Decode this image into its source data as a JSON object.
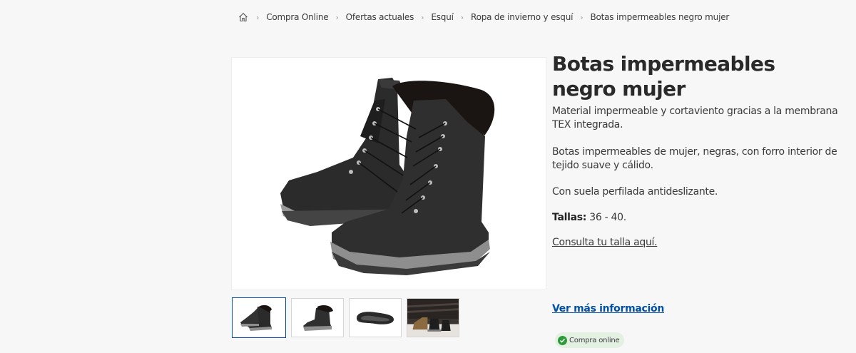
{
  "breadcrumb": {
    "home_icon": "home-icon",
    "items": [
      "Compra Online",
      "Ofertas actuales",
      "Esquí",
      "Ropa de invierno y esquí",
      "Botas impermeables negro mujer"
    ],
    "separator": "›"
  },
  "product": {
    "title": "Botas impermeables negro mujer",
    "description": [
      "Material impermeable y cortaviento gracias a la membrana TEX integrada.",
      "Botas impermeables de mujer, negras, con forro interior de tejido suave y cálido.",
      "Con suela perfilada antideslizante."
    ],
    "sizes_label": "Tallas:",
    "sizes_value": " 36 - 40.",
    "size_guide_link": "Consulta tu talla aquí.",
    "more_info_link": "Ver más información",
    "badge_label": "Compra online",
    "badge_icon": "check-circle-icon"
  },
  "gallery": {
    "thumbnails": [
      "boots-pair-thumbnail",
      "boot-side-thumbnail",
      "boot-sole-thumbnail",
      "lifestyle-thumbnail"
    ],
    "active_index": 0
  },
  "colors": {
    "link_blue": "#0050aa",
    "badge_green": "#2e9b3a",
    "badge_bg": "#e3f1e3"
  }
}
